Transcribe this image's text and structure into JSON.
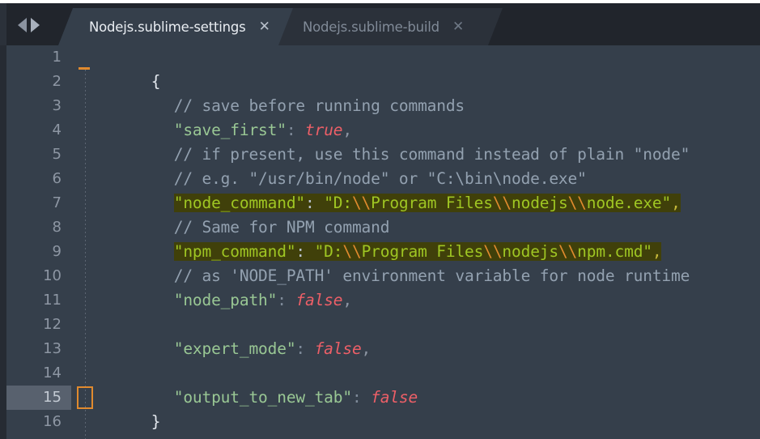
{
  "window": {
    "app": "Sublime Text",
    "theme_accent": "#e08a2e",
    "editor_background": "#353f4b",
    "tabbar_background": "#21252c",
    "highlight_background": "#40400a",
    "current_line_gutter": "#58616e"
  },
  "tabbar": {
    "nav_back_icon": "arrow-left-icon",
    "nav_forward_icon": "arrow-right-icon",
    "tabs": [
      {
        "label": "Nodejs.sublime-settings",
        "close_glyph": "✕",
        "active": true
      },
      {
        "label": "Nodejs.sublime-build",
        "close_glyph": "✕",
        "active": false
      }
    ]
  },
  "editor": {
    "language": "JSON",
    "current_line": 15,
    "gutter_numbers": [
      "1",
      "2",
      "3",
      "4",
      "5",
      "6",
      "7",
      "8",
      "9",
      "10",
      "11",
      "12",
      "13",
      "14",
      "15",
      "16"
    ],
    "lines": [
      {
        "n": 1,
        "text": "{"
      },
      {
        "n": 2,
        "text": "// save before running commands"
      },
      {
        "n": 3,
        "text": "\"save_first\": true,"
      },
      {
        "n": 4,
        "text": "// if present, use this command instead of plain \"node\""
      },
      {
        "n": 5,
        "text": "// e.g. \"/usr/bin/node\" or \"C:\\bin\\node.exe\""
      },
      {
        "n": 6,
        "text": "\"node_command\": \"D:\\\\Program Files\\\\nodejs\\\\node.exe\","
      },
      {
        "n": 7,
        "text": "// Same for NPM command"
      },
      {
        "n": 8,
        "text": "\"npm_command\": \"D:\\\\Program Files\\\\nodejs\\\\npm.cmd\","
      },
      {
        "n": 9,
        "text": "// as 'NODE_PATH' environment variable for node runtime"
      },
      {
        "n": 10,
        "text": "\"node_path\": false,"
      },
      {
        "n": 11,
        "text": ""
      },
      {
        "n": 12,
        "text": "\"expert_mode\": false,"
      },
      {
        "n": 13,
        "text": ""
      },
      {
        "n": 14,
        "text": "\"output_to_new_tab\": false"
      },
      {
        "n": 15,
        "text": "}"
      },
      {
        "n": 16,
        "text": ""
      }
    ],
    "tokens": {
      "l2_comment": "// save before running commands",
      "l3_key": "\"save_first\"",
      "l3_colon": ": ",
      "l3_value": "true",
      "l3_comma": ",",
      "l4_comment": "// if present, use this command instead of plain \"node\"",
      "l5_comment": "// e.g. \"/usr/bin/node\" or \"C:\\bin\\node.exe\"",
      "l6_key": "\"node_command\"",
      "l6_colon": ": ",
      "l6_str_a": "\"D:",
      "l6_esc_a": "\\\\",
      "l6_str_b": "Program Files",
      "l6_esc_b": "\\\\",
      "l6_str_c": "nodejs",
      "l6_esc_c": "\\\\",
      "l6_str_d": "node.exe\"",
      "l6_comma": ",",
      "l7_comment": "// Same for NPM command",
      "l8_key": "\"npm_command\"",
      "l8_colon": ": ",
      "l8_str_a": "\"D:",
      "l8_esc_a": "\\\\",
      "l8_str_b": "Program Files",
      "l8_esc_b": "\\\\",
      "l8_str_c": "nodejs",
      "l8_esc_c": "\\\\",
      "l8_str_d": "npm.cmd\"",
      "l8_comma": ",",
      "l9_comment": "// as 'NODE_PATH' environment variable for node runtime",
      "l10_key": "\"node_path\"",
      "l10_colon": ": ",
      "l10_value": "false",
      "l10_comma": ",",
      "l12_key": "\"expert_mode\"",
      "l12_colon": ": ",
      "l12_value": "false",
      "l12_comma": ",",
      "l14_key": "\"output_to_new_tab\"",
      "l14_colon": ": ",
      "l14_value": "false",
      "l1_brace": "{",
      "l15_brace": "}"
    }
  }
}
